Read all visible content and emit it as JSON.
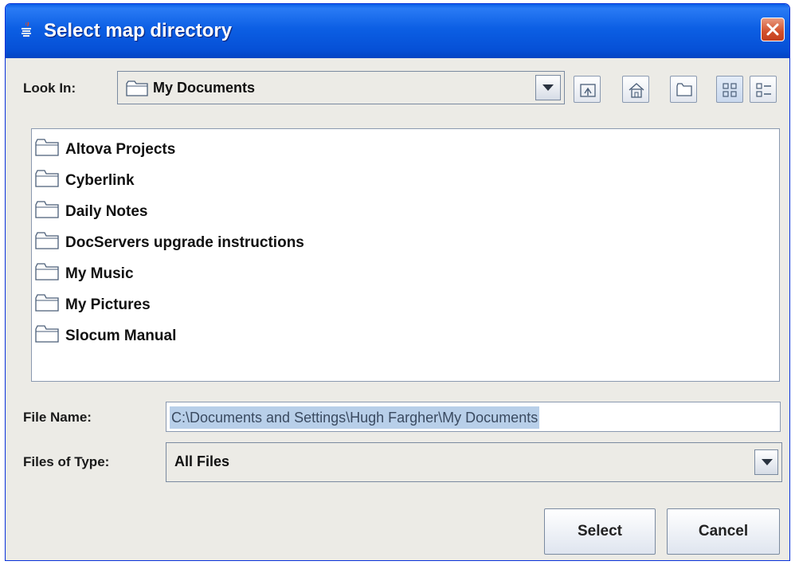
{
  "window": {
    "title": "Select map directory"
  },
  "look_in": {
    "label": "Look In:",
    "value": "My Documents"
  },
  "toolbar": {
    "up_icon": "up-one-level-icon",
    "home_icon": "home-icon",
    "new_folder_icon": "new-folder-icon",
    "list_icon": "list-view-icon",
    "details_icon": "details-view-icon"
  },
  "files": [
    "Altova Projects",
    "Cyberlink",
    "Daily Notes",
    "DocServers upgrade instructions",
    "My Music",
    "My Pictures",
    "Slocum Manual"
  ],
  "file_name": {
    "label": "File Name:",
    "value": "C:\\Documents and Settings\\Hugh Fargher\\My Documents"
  },
  "file_type": {
    "label": "Files of Type:",
    "value": "All Files"
  },
  "buttons": {
    "select": "Select",
    "cancel": "Cancel"
  }
}
